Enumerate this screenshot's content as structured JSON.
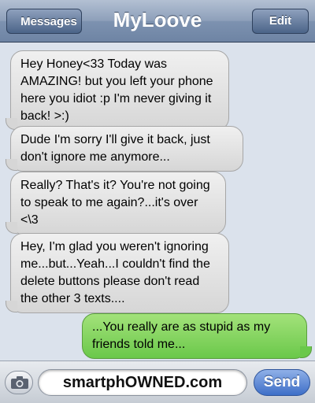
{
  "navbar": {
    "back_label": "Messages",
    "title": "MyLoove",
    "edit_label": "Edit"
  },
  "messages": [
    {
      "direction": "incoming",
      "text": "Hey Honey<33 Today was AMAZING! but you left your phone here you idiot :p I'm never giving it back! >:)"
    },
    {
      "direction": "incoming",
      "text": "Dude I'm sorry I'll give it back, just don't ignore me anymore..."
    },
    {
      "direction": "incoming",
      "text": "Really? That's it? You're not going to speak to me again?...it's over <\\3"
    },
    {
      "direction": "incoming",
      "text": "Hey, I'm glad you weren't ignoring me...but...Yeah...I couldn't find the delete buttons please don't read the other 3 texts...."
    },
    {
      "direction": "outgoing",
      "text": "...You really are as stupid as my friends told me..."
    }
  ],
  "composer": {
    "input_value": "smartphOWNED.com",
    "send_label": "Send",
    "camera_icon": "camera-icon"
  },
  "colors": {
    "incoming_bubble": "#e4e4e4",
    "outgoing_bubble": "#7fd35a",
    "navbar": "#7d92b0",
    "send_button": "#3e6fc8"
  }
}
